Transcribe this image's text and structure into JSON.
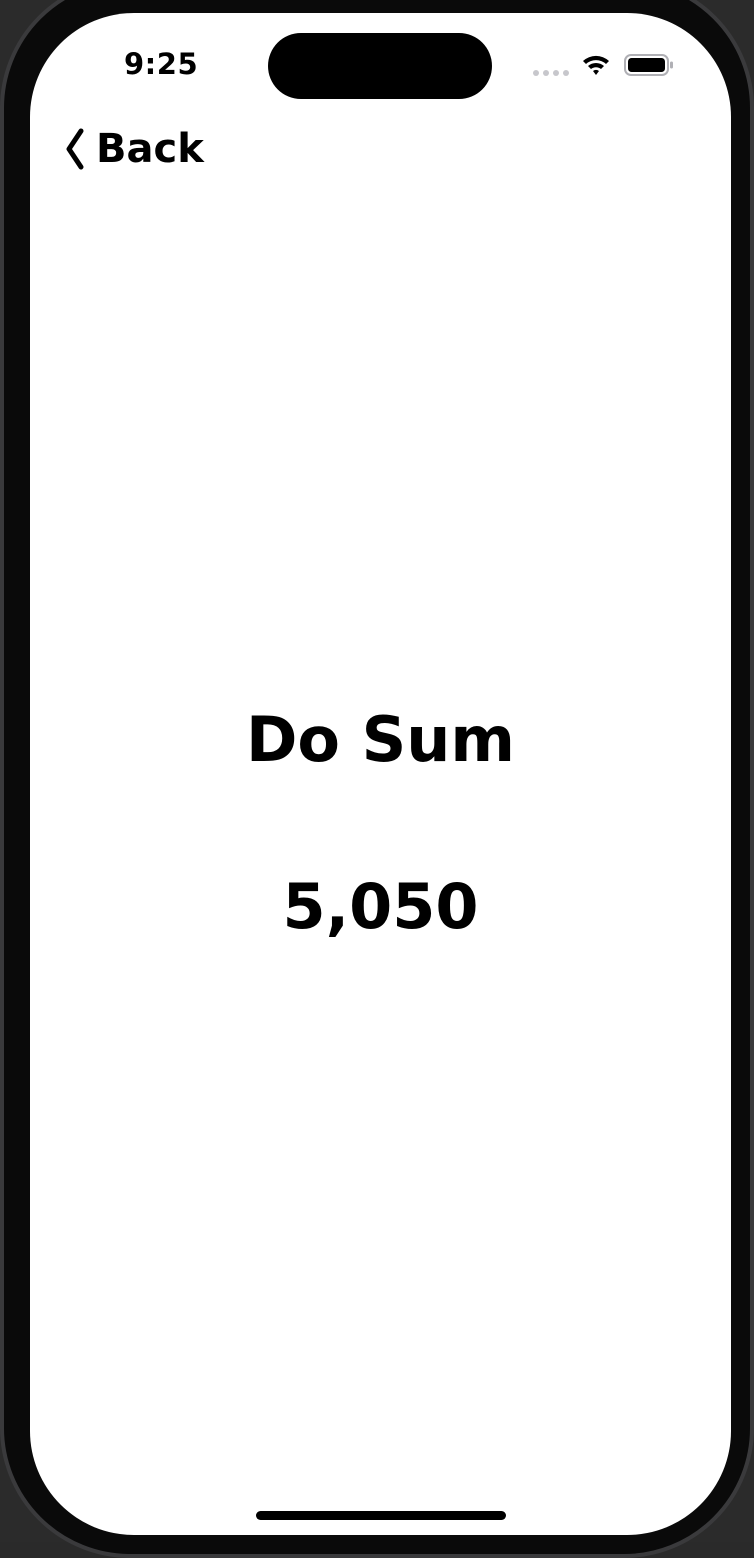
{
  "status_bar": {
    "time": "9:25",
    "icons": [
      "cellular-signal-icon",
      "wifi-icon",
      "battery-icon"
    ]
  },
  "nav": {
    "back_label": "Back",
    "back_icon": "chevron-left-icon"
  },
  "main": {
    "title": "Do Sum",
    "result": "5,050"
  },
  "colors": {
    "text": "#000000",
    "background": "#ffffff",
    "frame": "#0a0a0a"
  }
}
